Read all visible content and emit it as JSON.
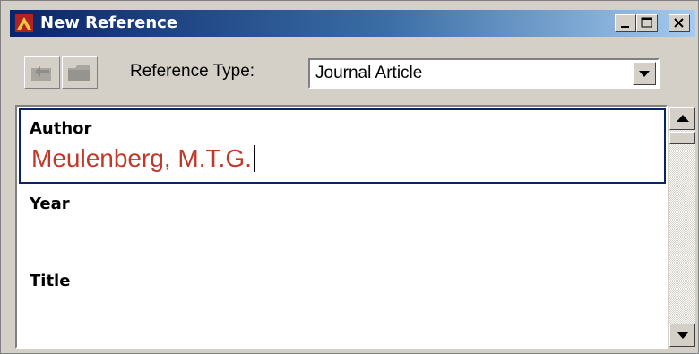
{
  "window": {
    "title": "New Reference",
    "icon": "endnote-app-icon",
    "buttons": [
      "minimize-icon",
      "maximize-icon",
      "close-icon"
    ]
  },
  "toolbar": {
    "buttons": [
      "back-icon",
      "folder-icon"
    ],
    "reference_type_label": "Reference Type:",
    "reference_type_value": "Journal Article"
  },
  "fields": {
    "author_label": "Author",
    "author_value": "Meulenberg, M.T.G.",
    "year_label": "Year",
    "year_value": "",
    "title_label": "Title",
    "title_value": ""
  },
  "colors": {
    "title_bar_start": "#0a246a",
    "title_bar_end": "#a6caf0",
    "author_text": "#c0392b",
    "focus_border": "#0a246a"
  }
}
